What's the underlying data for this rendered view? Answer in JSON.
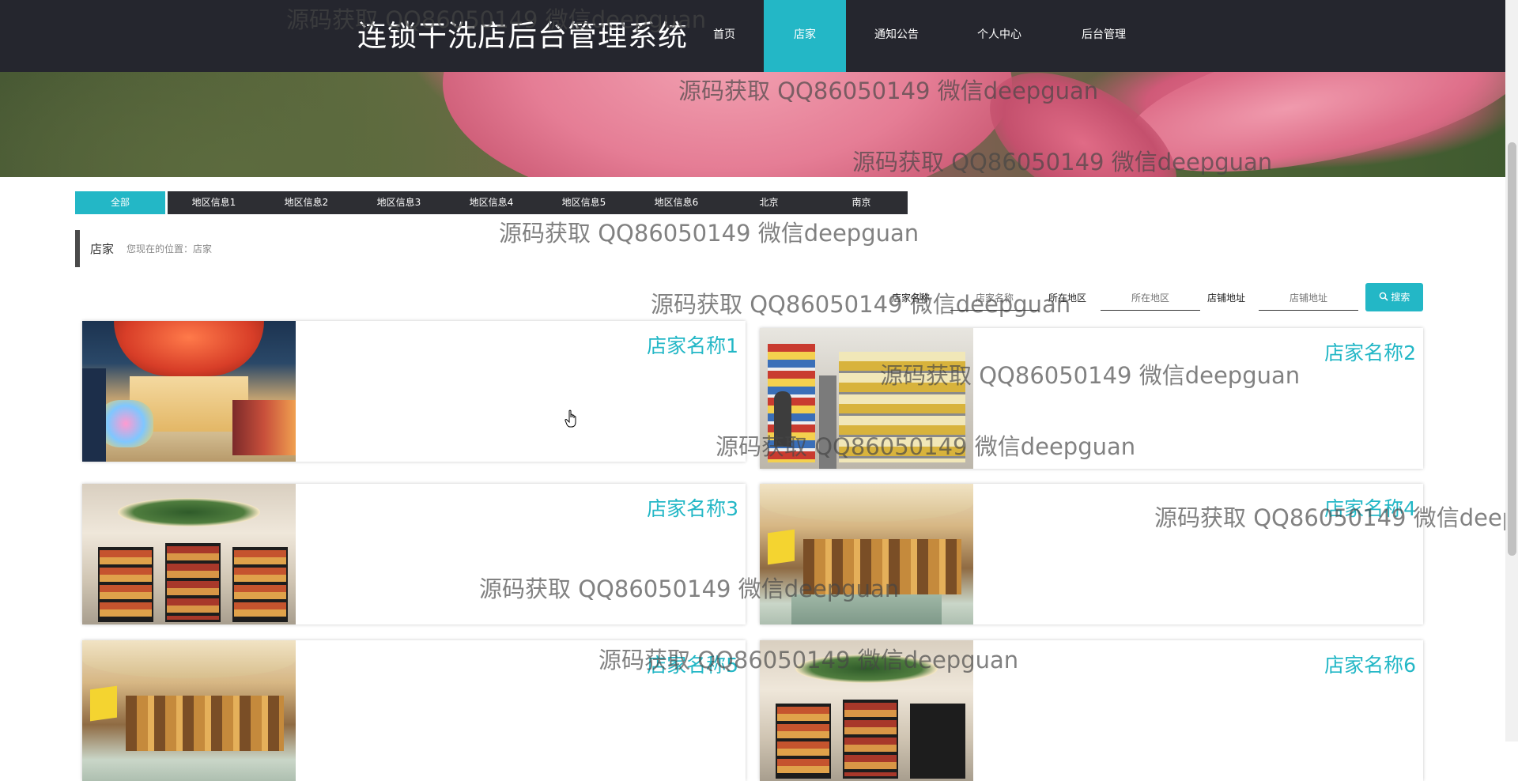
{
  "header": {
    "title": "连锁干洗店后台管理系统",
    "nav": [
      {
        "label": "首页",
        "active": false
      },
      {
        "label": "店家",
        "active": true
      },
      {
        "label": "通知公告",
        "active": false
      },
      {
        "label": "个人中心",
        "active": false
      },
      {
        "label": "后台管理",
        "active": false
      }
    ]
  },
  "categories": [
    "全部",
    "地区信息1",
    "地区信息2",
    "地区信息3",
    "地区信息4",
    "地区信息5",
    "地区信息6",
    "北京",
    "南京"
  ],
  "breadcrumb": {
    "title": "店家",
    "location": "您现在的位置：店家"
  },
  "search": {
    "fields": [
      {
        "label": "店家名称",
        "placeholder": "店家名称"
      },
      {
        "label": "所在地区",
        "placeholder": "所在地区"
      },
      {
        "label": "店铺地址",
        "placeholder": "店铺地址"
      }
    ],
    "button_label": "搜索",
    "button_icon": "search-icon"
  },
  "shops": [
    {
      "name": "店家名称1"
    },
    {
      "name": "店家名称2"
    },
    {
      "name": "店家名称3"
    },
    {
      "name": "店家名称4"
    },
    {
      "name": "店家名称5"
    },
    {
      "name": "店家名称6"
    }
  ],
  "watermark": "源码获取 QQ86050149 微信deepguan",
  "colors": {
    "accent": "#23b7c6",
    "header_bg": "#25262e",
    "category_bg": "#2d2e33"
  }
}
